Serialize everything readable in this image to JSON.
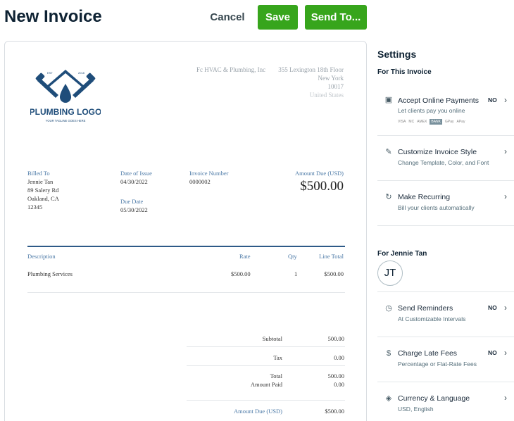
{
  "header": {
    "title": "New Invoice",
    "cancel_label": "Cancel",
    "save_label": "Save",
    "send_label": "Send To..."
  },
  "invoice": {
    "logo": {
      "text": "PLUMBING LOGO",
      "tagline": "YOUR TAGLINE GOES HERE",
      "est": "EST",
      "year": "2018"
    },
    "business_name": "Fc HVAC & Plumbing, Inc",
    "business_address": [
      "355 Lexington 18th Floor",
      "New York",
      "10017"
    ],
    "business_country": "United States",
    "billed_to": {
      "label": "Billed To",
      "lines": [
        "Jennie Tan",
        "89 Salery Rd",
        "Oakland, CA",
        "12345"
      ]
    },
    "date_of_issue": {
      "label": "Date of Issue",
      "value": "04/30/2022"
    },
    "due_date": {
      "label": "Due Date",
      "value": "05/30/2022"
    },
    "invoice_number": {
      "label": "Invoice Number",
      "value": "0000002"
    },
    "amount_due": {
      "label": "Amount Due (USD)",
      "value": "$500.00"
    },
    "table": {
      "headers": {
        "description": "Description",
        "rate": "Rate",
        "qty": "Qty",
        "line_total": "Line Total"
      },
      "rows": [
        {
          "description": "Plumbing Services",
          "rate": "$500.00",
          "qty": "1",
          "line_total": "$500.00"
        }
      ]
    },
    "totals": {
      "subtotal_label": "Subtotal",
      "subtotal": "500.00",
      "tax_label": "Tax",
      "tax": "0.00",
      "total_label": "Total",
      "total": "500.00",
      "paid_label": "Amount Paid",
      "paid": "0.00",
      "due_label": "Amount Due (USD)",
      "due": "$500.00"
    }
  },
  "settings": {
    "title": "Settings",
    "for_invoice_label": "For This Invoice",
    "online_payments": {
      "name": "Accept Online Payments",
      "desc": "Let clients pay you online",
      "status": "NO",
      "icons": [
        "VISA",
        "MC",
        "AMEX",
        "BANK",
        "GPay",
        "APay"
      ]
    },
    "style": {
      "name": "Customize Invoice Style",
      "desc": "Change Template, Color, and Font"
    },
    "recurring": {
      "name": "Make Recurring",
      "desc": "Bill your clients automatically"
    },
    "for_client_label": "For Jennie Tan",
    "avatar_initials": "JT",
    "reminders": {
      "name": "Send Reminders",
      "desc": "At Customizable Intervals",
      "status": "NO"
    },
    "late_fees": {
      "name": "Charge Late Fees",
      "desc": "Percentage or Flat-Rate Fees",
      "status": "NO"
    },
    "currency": {
      "name": "Currency & Language",
      "desc": "USD, English"
    }
  }
}
